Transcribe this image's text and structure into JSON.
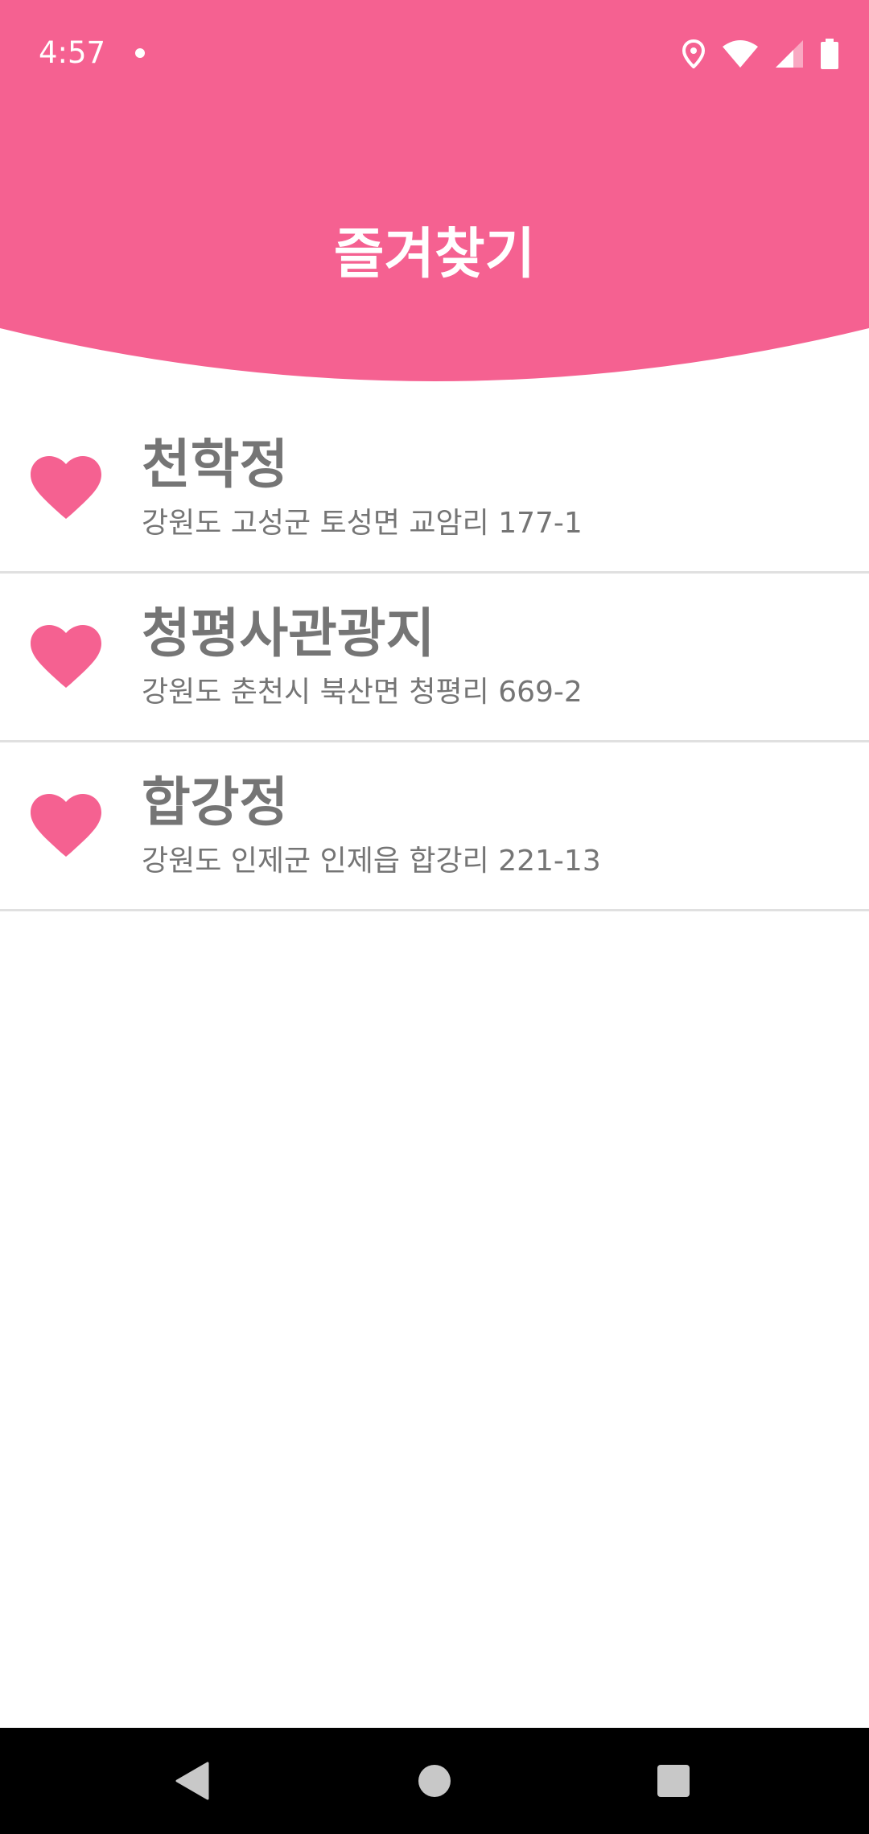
{
  "status_bar": {
    "time": "4:57",
    "icons": [
      "notification-dot-icon",
      "location-pin-icon",
      "wifi-icon",
      "cell-signal-icon",
      "battery-icon"
    ]
  },
  "header": {
    "title": "즐겨찾기",
    "background_color": "#F56191"
  },
  "favorites": {
    "accent_color": "#F56191",
    "items": [
      {
        "name": "천학정",
        "address": "강원도 고성군 토성면 교암리 177-1",
        "icon": "heart-icon"
      },
      {
        "name": "청평사관광지",
        "address": "강원도 춘천시 북산면 청평리 669-2",
        "icon": "heart-icon"
      },
      {
        "name": "합강정",
        "address": "강원도 인제군 인제읍 합강리 221-13",
        "icon": "heart-icon"
      }
    ]
  },
  "nav_bar": {
    "buttons": [
      "back-icon",
      "home-icon",
      "recents-icon"
    ]
  }
}
